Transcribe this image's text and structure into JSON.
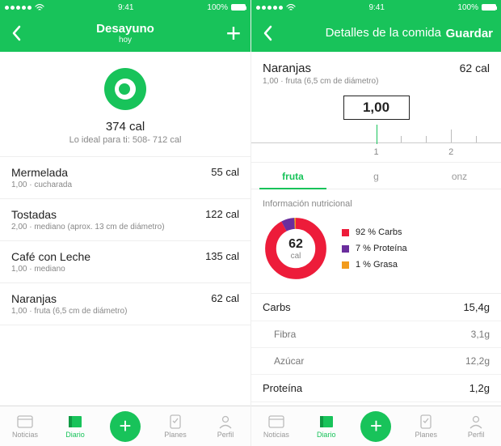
{
  "status": {
    "time": "9:41",
    "battery": "100%"
  },
  "colors": {
    "accent": "#18c35a",
    "carbs": "#ed1c3a",
    "protein": "#6a2e9d",
    "fat": "#f29b1c"
  },
  "left": {
    "nav": {
      "title": "Desayuno",
      "subtitle": "hoy"
    },
    "summary": {
      "cal": "374 cal",
      "hint": "Lo ideal para ti: 508- 712 cal"
    },
    "items": [
      {
        "name": "Mermelada",
        "sub": "1,00 · cucharada",
        "cal": "55 cal"
      },
      {
        "name": "Tostadas",
        "sub": "2,00 · mediano (aprox. 13 cm de diámetro)",
        "cal": "122 cal"
      },
      {
        "name": "Café con Leche",
        "sub": "1,00 · mediano",
        "cal": "135 cal"
      },
      {
        "name": "Naranjas",
        "sub": "1,00 · fruta (6,5 cm de diámetro)",
        "cal": "62 cal"
      }
    ]
  },
  "right": {
    "nav": {
      "title": "Detalles de la comida",
      "action": "Guardar"
    },
    "food": {
      "name": "Naranjas",
      "sub": "1,00 · fruta (6,5 cm de diámetro)",
      "cal": "62 cal"
    },
    "amount": "1,00",
    "ruler_labels": {
      "one": "1",
      "two": "2"
    },
    "units": [
      "fruta",
      "g",
      "onz"
    ],
    "nutri_title": "Información nutricional",
    "legend": [
      {
        "label": "92 % Carbs",
        "color": "#ed1c3a"
      },
      {
        "label": "7 % Proteína",
        "color": "#6a2e9d"
      },
      {
        "label": "1 % Grasa",
        "color": "#f29b1c"
      }
    ],
    "donut_center": {
      "val": "62",
      "cal": "cal"
    },
    "nutrients": [
      {
        "name": "Carbs",
        "val": "15,4g",
        "sub": false
      },
      {
        "name": "Fibra",
        "val": "3,1g",
        "sub": true
      },
      {
        "name": "Azúcar",
        "val": "12,2g",
        "sub": true
      },
      {
        "name": "Proteína",
        "val": "1,2g",
        "sub": false
      }
    ]
  },
  "tabs": [
    "Noticias",
    "Diario",
    "",
    "Planes",
    "Perfil"
  ],
  "chart_data": {
    "type": "pie",
    "title": "Información nutricional",
    "note": "donut showing macronutrient calorie share for 1 Naranja (~62 cal)",
    "series": [
      {
        "name": "Carbs",
        "pct": 92,
        "color": "#ed1c3a"
      },
      {
        "name": "Proteína",
        "pct": 7,
        "color": "#6a2e9d"
      },
      {
        "name": "Grasa",
        "pct": 1,
        "color": "#f29b1c"
      }
    ]
  }
}
